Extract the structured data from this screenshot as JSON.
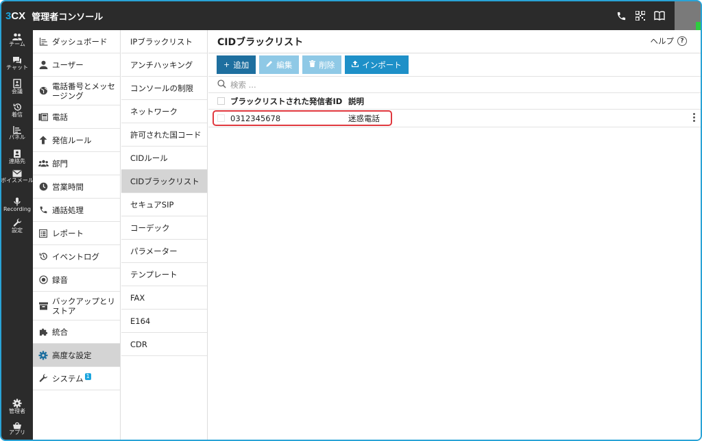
{
  "app": {
    "logo_prefix": "3",
    "logo_suffix": "CX",
    "title": "管理者コンソール"
  },
  "topbar_icons": [
    "phone-icon",
    "qr-code-icon",
    "book-icon"
  ],
  "rail": {
    "items": [
      {
        "label": "チーム",
        "icon": "team-icon"
      },
      {
        "label": "チャット",
        "icon": "chat-icon"
      },
      {
        "label": "会議",
        "icon": "meeting-icon"
      },
      {
        "label": "着信",
        "icon": "history-icon"
      },
      {
        "label": "パネル",
        "icon": "panel-icon"
      },
      {
        "label": "連絡先",
        "icon": "contacts-icon"
      },
      {
        "label": "ボイスメール",
        "icon": "voicemail-icon"
      },
      {
        "label": "Recording",
        "icon": "microphone-icon"
      },
      {
        "label": "設定",
        "icon": "wrench-icon"
      }
    ],
    "bottom": [
      {
        "label": "管理者",
        "icon": "gear-icon"
      },
      {
        "label": "アプリ",
        "icon": "apps-icon"
      }
    ]
  },
  "nav1": {
    "items": [
      {
        "label": "ダッシュボード",
        "icon": "dashboard-icon"
      },
      {
        "label": "ユーザー",
        "icon": "user-icon"
      },
      {
        "label": "電話番号とメッセージング",
        "icon": "globe-icon"
      },
      {
        "label": "電話",
        "icon": "phone-device-icon"
      },
      {
        "label": "発信ルール",
        "icon": "arrow-up-icon"
      },
      {
        "label": "部門",
        "icon": "group-icon"
      },
      {
        "label": "営業時間",
        "icon": "clock-icon"
      },
      {
        "label": "通話処理",
        "icon": "call-handling-icon"
      },
      {
        "label": "レポート",
        "icon": "report-icon"
      },
      {
        "label": "イベントログ",
        "icon": "event-log-icon"
      },
      {
        "label": "録音",
        "icon": "record-icon"
      },
      {
        "label": "バックアップとリストア",
        "icon": "backup-icon"
      },
      {
        "label": "統合",
        "icon": "puzzle-icon"
      },
      {
        "label": "高度な設定",
        "icon": "gear-icon"
      },
      {
        "label": "システム",
        "icon": "wrench-icon",
        "badge": "1"
      }
    ],
    "active_index": 13
  },
  "nav2": {
    "items": [
      "IPブラックリスト",
      "アンチハッキング",
      "コンソールの制限",
      "ネットワーク",
      "許可された国コード",
      "CIDルール",
      "CIDブラックリスト",
      "セキュアSIP",
      "コーデック",
      "パラメーター",
      "テンプレート",
      "FAX",
      "E164",
      "CDR"
    ],
    "active_index": 6
  },
  "main": {
    "title": "CIDブラックリスト",
    "help_label": "ヘルプ",
    "toolbar": {
      "add_label": "追加",
      "edit_label": "編集",
      "delete_label": "削除",
      "import_label": "インポート"
    },
    "search": {
      "placeholder": "検索 ..."
    },
    "table": {
      "columns": [
        "ブラックリストされた発信者ID",
        "説明"
      ],
      "rows": [
        {
          "caller_id": "0312345678",
          "description": "迷惑電話"
        }
      ]
    }
  },
  "colors": {
    "accent": "#1ca5de",
    "topbar": "#2b2b2b",
    "primary_button": "#1e6f9f",
    "disabled_button": "#8fc9e6",
    "highlight": "#e0383e"
  }
}
